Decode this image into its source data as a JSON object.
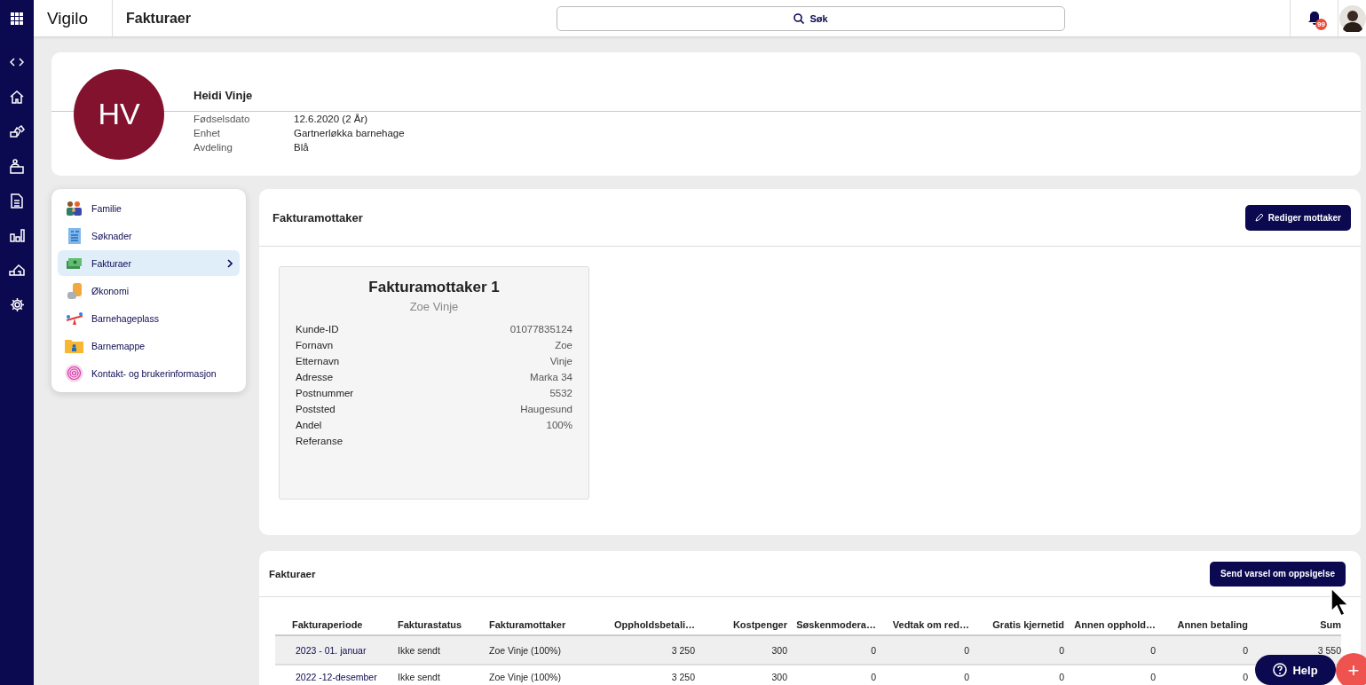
{
  "app": {
    "name": "Vigilo",
    "page_title": "Fakturaer"
  },
  "search": {
    "label": "Søk"
  },
  "notifications": {
    "badge": "99"
  },
  "rail": [
    {
      "kind": "code"
    },
    {
      "kind": "home"
    },
    {
      "kind": "blocks"
    },
    {
      "kind": "desk"
    },
    {
      "kind": "document"
    },
    {
      "kind": "chart"
    },
    {
      "kind": "house"
    },
    {
      "kind": "settings"
    }
  ],
  "profile": {
    "initials": "HV",
    "name": "Heidi Vinje",
    "fields": [
      {
        "label": "Fødselsdato",
        "value": "12.6.2020 (2 År)"
      },
      {
        "label": "Enhet",
        "value": "Gartnerløkka barnehage"
      },
      {
        "label": "Avdeling",
        "value": "Blå"
      }
    ]
  },
  "menu": [
    {
      "label": "Familie",
      "kind": "family",
      "selected": false
    },
    {
      "label": "Søknader",
      "kind": "form",
      "selected": false
    },
    {
      "label": "Fakturaer",
      "kind": "money",
      "selected": true
    },
    {
      "label": "Økonomi",
      "kind": "coins",
      "selected": false
    },
    {
      "label": "Barnehageplass",
      "kind": "seesaw",
      "selected": false
    },
    {
      "label": "Barnemappe",
      "kind": "folder",
      "selected": false
    },
    {
      "label": "Kontakt- og brukerinformasjon",
      "kind": "fingerprint",
      "selected": false
    }
  ],
  "recipient_panel": {
    "title": "Fakturamottaker",
    "button": "Rediger mottaker",
    "card": {
      "title": "Fakturamottaker 1",
      "subtitle": "Zoe Vinje",
      "fields": [
        {
          "label": "Kunde-ID",
          "value": "01077835124"
        },
        {
          "label": "Fornavn",
          "value": "Zoe"
        },
        {
          "label": "Etternavn",
          "value": "Vinje"
        },
        {
          "label": "Adresse",
          "value": "Marka 34"
        },
        {
          "label": "Postnummer",
          "value": "5532"
        },
        {
          "label": "Poststed",
          "value": "Haugesund"
        },
        {
          "label": "Andel",
          "value": "100%"
        },
        {
          "label": "Referanse"
        }
      ]
    }
  },
  "invoices_panel": {
    "title": "Fakturaer",
    "button": "Send varsel om oppsigelse",
    "table": {
      "columns": [
        "Fakturaperiode",
        "Fakturastatus",
        "Fakturamottaker",
        "Oppholdsbetali…",
        "Kostpenger",
        "Søskenmodera…",
        "Vedtak om red…",
        "Gratis kjernetid",
        "Annen opphold…",
        "Annen betaling",
        "Sum"
      ],
      "rows": [
        {
          "highlighted": true,
          "cells": [
            "2023 - 01. januar",
            "Ikke sendt",
            "Zoe Vinje (100%)",
            "3 250",
            "300",
            "0",
            "0",
            "0",
            "0",
            "0",
            "3 550"
          ]
        },
        {
          "highlighted": false,
          "cells": [
            "2022 -12-desember",
            "Ikke sendt",
            "Zoe Vinje (100%)",
            "3 250",
            "300",
            "0",
            "0",
            "0",
            "0",
            "0"
          ]
        }
      ]
    }
  },
  "help_button": "Help",
  "add_button": "+"
}
